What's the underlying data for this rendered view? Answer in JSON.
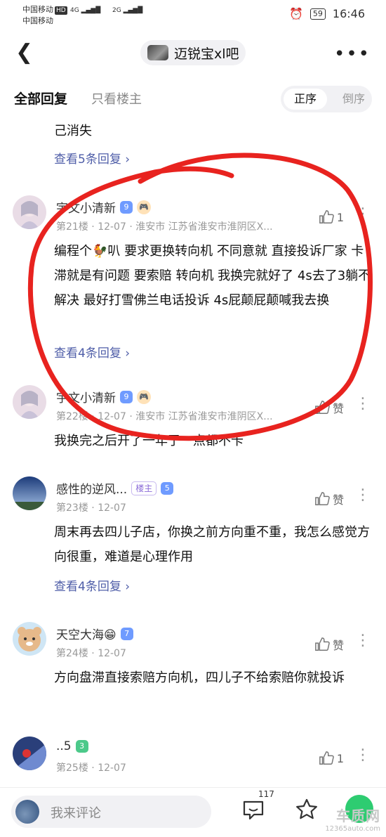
{
  "status_bar": {
    "carrier1": "中国移动",
    "carrier1_tag": "HD",
    "carrier2": "中国移动",
    "signal1": "4G",
    "signal2": "2G",
    "battery": "59",
    "time": "16:46"
  },
  "nav": {
    "forum_name": "迈锐宝xl吧"
  },
  "tabs": {
    "all_replies": "全部回复",
    "op_only": "只看楼主",
    "sort_asc": "正序",
    "sort_desc": "倒序"
  },
  "prev_post": {
    "text_tail": "己消失",
    "replies_link": "查看5条回复"
  },
  "posts": [
    {
      "username": "宇文小清新",
      "level": "9",
      "floor": "第21楼",
      "date": "12-07",
      "location": "淮安市 江苏省淮安市淮阴区X...",
      "likes": "1",
      "text": "编程个🐓叭 要求更换转向机 不同意就 直接投诉厂家 卡滞就是有问题 要索赔 转向机 我换完就好了 4s去了3躺不解决 最好打雪佛兰电话投诉 4s屁颠屁颠喊我去换",
      "replies_link": "查看4条回复"
    },
    {
      "username": "宇文小清新",
      "level": "9",
      "floor": "第22楼",
      "date": "12-07",
      "location": "淮安市 江苏省淮安市淮阴区X...",
      "likes": "赞",
      "text": "我换完之后开了一年了一点都不卡"
    },
    {
      "username": "感性的逆风...",
      "badge": "楼主",
      "level": "5",
      "floor": "第23楼",
      "date": "12-07",
      "likes": "赞",
      "text": "周末再去四儿子店，你换之前方向重不重，我怎么感觉方向很重，难道是心理作用",
      "replies_link": "查看4条回复"
    },
    {
      "username": "天空大海😁",
      "level": "7",
      "floor": "第24楼",
      "date": "12-07",
      "likes": "赞",
      "text": "方向盘滞直接索赔方向机，四儿子不给索赔你就投诉"
    },
    {
      "username": "..5",
      "level": "3",
      "floor": "第25楼",
      "date": "12-07",
      "likes": "1"
    }
  ],
  "bottom_bar": {
    "comment_placeholder": "我来评论",
    "comment_count": "117"
  },
  "watermark": {
    "line1": "车质网",
    "line2": "12365auto.com"
  },
  "colors": {
    "link": "#4f5ea8",
    "annotation": "#e8231f",
    "level_blue": "#6f9bff",
    "level_green": "#4cc98a"
  }
}
